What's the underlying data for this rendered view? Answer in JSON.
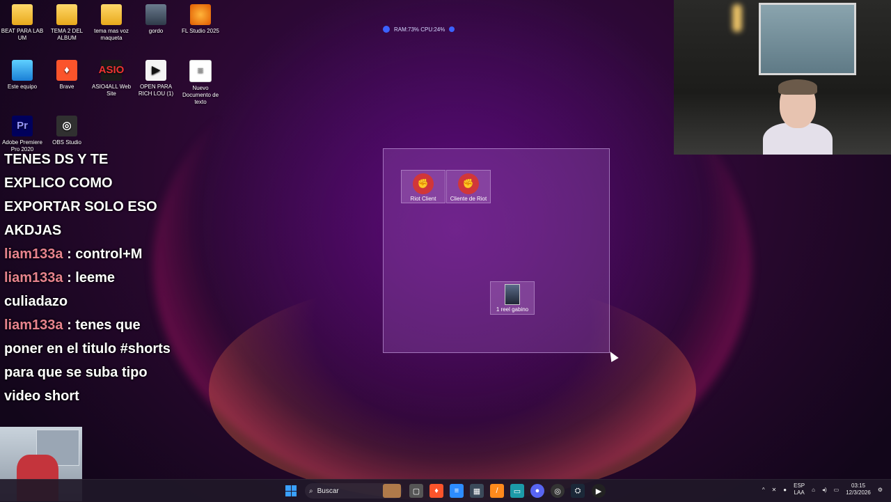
{
  "desktop_icons": [
    {
      "label": "BEAT PARA LAB UM",
      "glyph": "",
      "icon": "folder-icon"
    },
    {
      "label": "TEMA 2 DEL ALBUM",
      "glyph": "",
      "icon": "folder-icon"
    },
    {
      "label": "tema mas voz maqueta",
      "glyph": "",
      "icon": "folder-icon"
    },
    {
      "label": "gordo",
      "glyph": "",
      "icon": "image-file-icon"
    },
    {
      "label": "FL Studio 2025",
      "glyph": "",
      "icon": "fl-studio-icon"
    },
    {
      "label": "Este equipo",
      "glyph": "",
      "icon": "computer-icon"
    },
    {
      "label": "Brave",
      "glyph": "♦",
      "icon": "brave-icon"
    },
    {
      "label": "ASIO4ALL Web Site",
      "glyph": "ASIO",
      "icon": "asio-icon"
    },
    {
      "label": "OPEN PARA RICH LOU (1)",
      "glyph": "▶",
      "icon": "media-file-icon"
    },
    {
      "label": "Nuevo Documento de texto",
      "glyph": "≡",
      "icon": "text-document-icon"
    },
    {
      "label": "Adobe Premiere Pro 2020",
      "glyph": "Pr",
      "icon": "premiere-icon"
    },
    {
      "label": "OBS Studio",
      "glyph": "◎",
      "icon": "obs-icon"
    }
  ],
  "perf_overlay": "RAM:73%   CPU:24%",
  "selection_icons": [
    {
      "label": "Riot Client"
    },
    {
      "label": "Cliente de Riot"
    },
    {
      "label": "1 reel gabino"
    }
  ],
  "chat": {
    "header": "TENES DS Y TE EXPLICO COMO EXPORTAR SOLO ESO AKDJAS",
    "messages": [
      {
        "user": "liam133a",
        "sep": " : ",
        "text": "control+M"
      },
      {
        "user": "liam133a",
        "sep": " : ",
        "text": "leeme culiadazo"
      },
      {
        "user": "liam133a",
        "sep": " : ",
        "text": "tenes que poner en el titulo #shorts para que se suba tipo video short"
      }
    ]
  },
  "taskbar": {
    "search_label": "Buscar",
    "lang_top": "ESP",
    "lang_bottom": "LAA",
    "time": "03:15",
    "date": "12/3/2026"
  },
  "colors": {
    "chat_username": "#e7838e",
    "win_accent": "#3aa0ff"
  }
}
